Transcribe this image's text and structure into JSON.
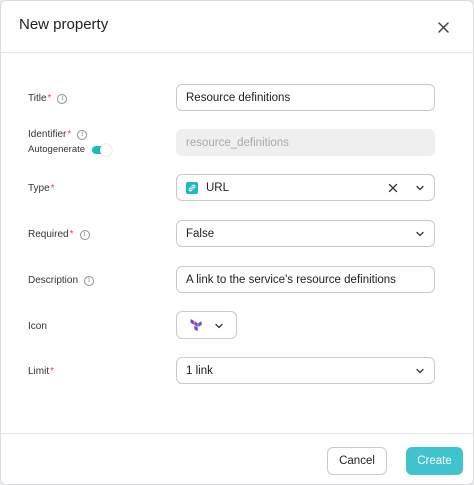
{
  "dialog": {
    "title": "New property",
    "close_icon": "close-icon"
  },
  "fields": {
    "title": {
      "label": "Title",
      "required": "*",
      "value": "Resource definitions"
    },
    "identifier": {
      "label": "Identifier",
      "required": "*",
      "value": "resource_definitions",
      "autogenerate_label": "Autogenerate",
      "autogenerate_on": true
    },
    "type": {
      "label": "Type",
      "required": "*",
      "value": "URL",
      "icon": "link-icon"
    },
    "required": {
      "label": "Required",
      "required": "*",
      "value": "False"
    },
    "description": {
      "label": "Description",
      "value": "A link to the service's resource definitions"
    },
    "icon": {
      "label": "Icon",
      "value_icon": "terraform-icon"
    },
    "limit": {
      "label": "Limit",
      "required": "*",
      "value": "1 link"
    }
  },
  "footer": {
    "cancel_label": "Cancel",
    "create_label": "Create"
  },
  "colors": {
    "accent": "#3fc4cf",
    "required_marker": "#e5484d",
    "terraform_purple": "#7b42bc"
  }
}
